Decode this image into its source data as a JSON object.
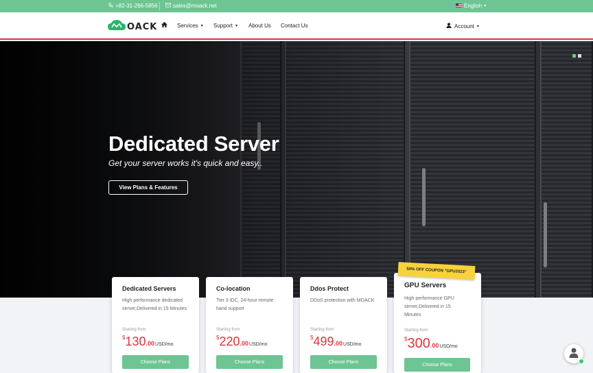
{
  "topbar": {
    "phone": "+82-31-266-5856",
    "email": "sales@moack.net",
    "language": "English"
  },
  "navbar": {
    "logo_text": "OACK",
    "menu": [
      "Services",
      "Support",
      "About Us",
      "Contact Us"
    ],
    "account": "Account"
  },
  "hero": {
    "title": "Dedicated Server",
    "subtitle": "Get your server works it's quick and easy..",
    "button": "View Plans & Features"
  },
  "plans": [
    {
      "title": "Dedicated Servers",
      "desc1": "High performance dedicated",
      "desc2": "server,Delivered in 15 Minutes",
      "desc3": "",
      "starting": "Starting from",
      "currency": "$",
      "price_int": "130",
      "price_dec": ".00",
      "unit": "USD/mo",
      "button": "Choose Plans"
    },
    {
      "title": "Co-location",
      "desc1": "Tier 3 IDC, 24-hour remote",
      "desc2": "hand support",
      "desc3": "",
      "starting": "Starting from",
      "currency": "$",
      "price_int": "220",
      "price_dec": ".00",
      "unit": "USD/mo",
      "button": "Choose Plans"
    },
    {
      "title": "Ddos Protect",
      "desc1": "DDoS protection with MOACK",
      "desc2": "",
      "desc3": "",
      "starting": "Starting from",
      "currency": "$",
      "price_int": "499",
      "price_dec": ".00",
      "unit": "USD/mo",
      "button": "Choose Plans"
    },
    {
      "title": "GPU Servers",
      "desc1": "High performance GPU",
      "desc2": "server,Delivered in 15",
      "desc3": "Minutes",
      "starting": "Starting from",
      "currency": "$",
      "price_int": "300",
      "price_dec": ".00",
      "unit": "USD/mo",
      "button": "Choose Plans",
      "coupon": "50% OFF COUPON \"GPU2023\""
    }
  ],
  "colors": {
    "accent": "#6cc592",
    "price": "#d9363e",
    "border_red": "#d9363e",
    "coupon": "#f7d23b"
  },
  "icons": {
    "phone": "phone-icon",
    "email": "envelope-icon",
    "language": "flag-icon",
    "home": "home-icon",
    "account": "user-icon",
    "chat": "chat-avatar-icon"
  }
}
